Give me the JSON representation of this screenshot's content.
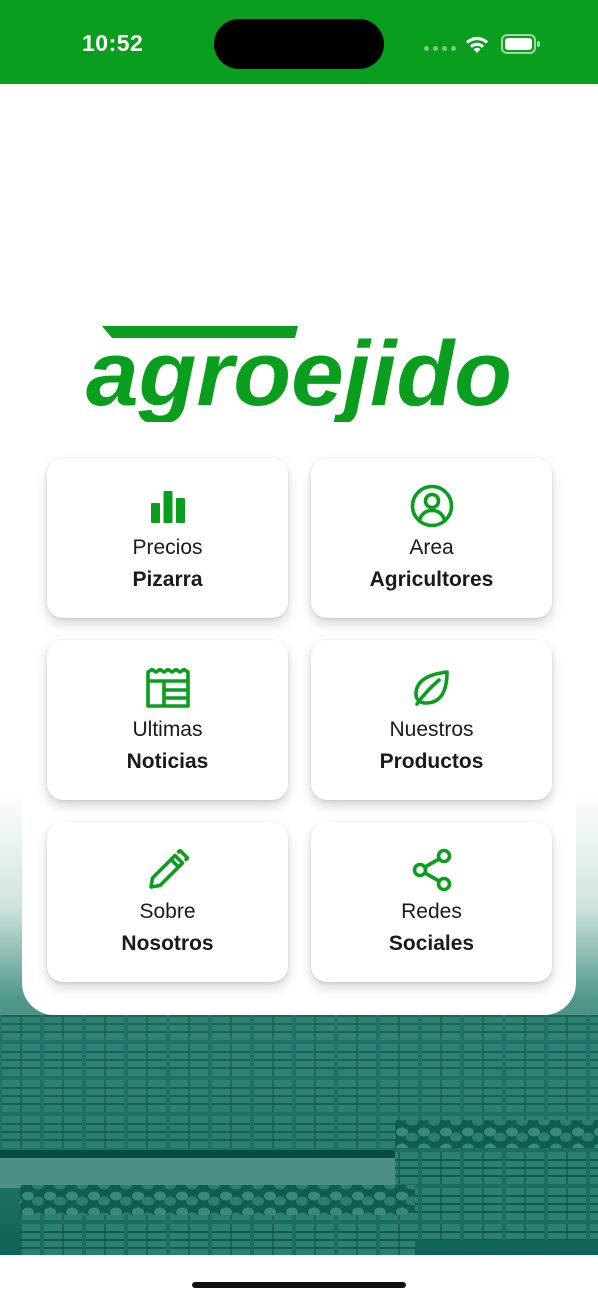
{
  "status_bar": {
    "time": "10:52",
    "color": "#0a9e1e"
  },
  "brand": {
    "name": "Agroejido",
    "color": "#0a9e1e"
  },
  "menu": [
    {
      "icon": "bar-chart-icon",
      "line1": "Precios",
      "line2": "Pizarra"
    },
    {
      "icon": "user-circle-icon",
      "line1": "Area",
      "line2": "Agricultores"
    },
    {
      "icon": "newspaper-icon",
      "line1": "Ultimas",
      "line2": "Noticias"
    },
    {
      "icon": "leaf-icon",
      "line1": "Nuestros",
      "line2": "Productos"
    },
    {
      "icon": "pencil-icon",
      "line1": "Sobre",
      "line2": "Nosotros"
    },
    {
      "icon": "share-icon",
      "line1": "Redes",
      "line2": "Sociales"
    }
  ]
}
